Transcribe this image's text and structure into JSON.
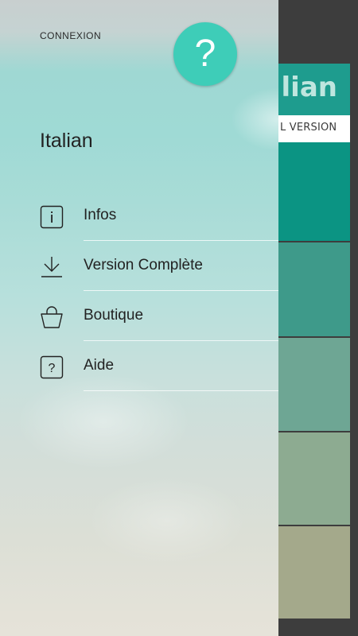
{
  "background_app": {
    "title": "lian",
    "version_label": "L VERSION"
  },
  "drawer": {
    "login_link": "CONNEXION",
    "help_icon_glyph": "?",
    "course_title": "Italian",
    "menu": [
      {
        "label": "Infos",
        "icon": "info-icon"
      },
      {
        "label": "Version Complète",
        "icon": "download-icon"
      },
      {
        "label": "Boutique",
        "icon": "shopping-bag-icon"
      },
      {
        "label": "Aide",
        "icon": "help-icon"
      }
    ]
  },
  "colors": {
    "accent": "#3ecdb8",
    "header_teal": "#1e9c8e",
    "text_dark": "#222222"
  }
}
